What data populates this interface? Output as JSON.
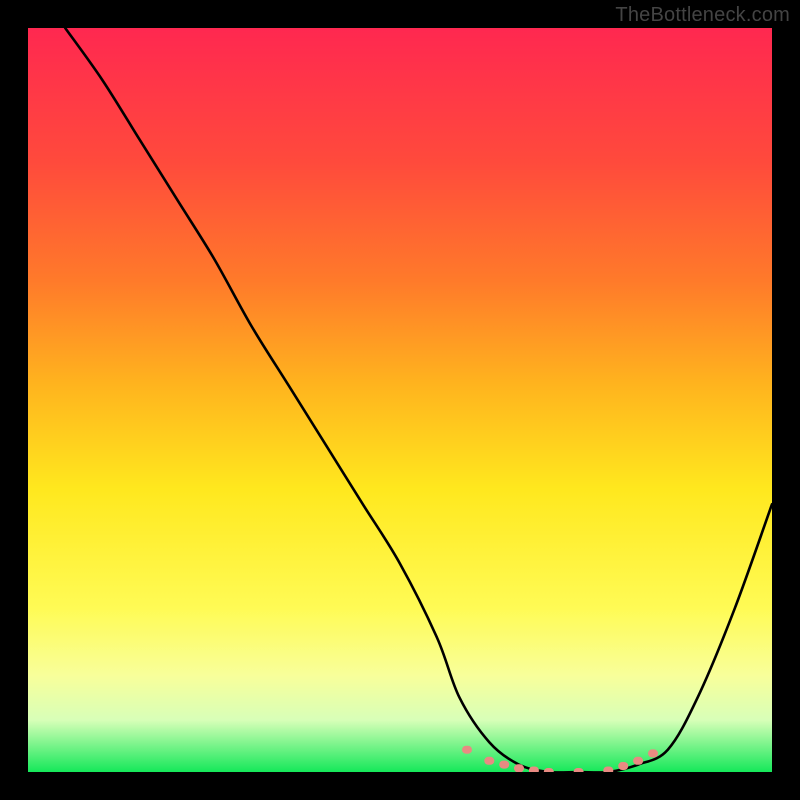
{
  "watermark": "TheBottleneck.com",
  "chart_data": {
    "type": "line",
    "title": "",
    "xlabel": "",
    "ylabel": "",
    "xlim": [
      0,
      100
    ],
    "ylim": [
      0,
      100
    ],
    "background_gradient": {
      "top": "#ff2850",
      "mid_upper": "#ffb41e",
      "mid_lower": "#fffb55",
      "bottom": "#15e85a"
    },
    "series": [
      {
        "name": "bottleneck-curve",
        "color": "#000000",
        "x": [
          5,
          10,
          15,
          20,
          25,
          30,
          35,
          40,
          45,
          50,
          55,
          58,
          62,
          66,
          70,
          74,
          78,
          82,
          86,
          90,
          95,
          100
        ],
        "y": [
          100,
          93,
          85,
          77,
          69,
          60,
          52,
          44,
          36,
          28,
          18,
          10,
          4,
          1,
          0,
          0,
          0,
          1,
          3,
          10,
          22,
          36
        ]
      },
      {
        "name": "optimal-band-markers",
        "type": "scatter",
        "color": "#e98a82",
        "x": [
          59,
          62,
          64,
          66,
          68,
          70,
          74,
          78,
          80,
          82,
          84
        ],
        "y": [
          3,
          1.5,
          1,
          0.5,
          0.2,
          0,
          0,
          0.2,
          0.8,
          1.5,
          2.5
        ]
      }
    ]
  }
}
